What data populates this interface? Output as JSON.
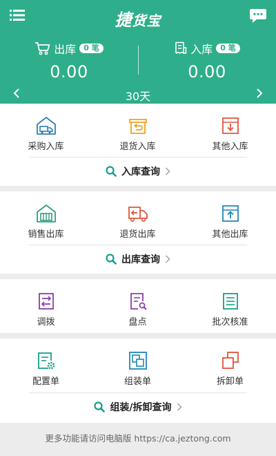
{
  "header": {
    "brand_char": "捷",
    "brand_rest": "货宝",
    "menu_icon": "hamburger-icon",
    "message_icon": "chat-icon"
  },
  "stats": {
    "outbound": {
      "label": "出库",
      "badge": "0 笔",
      "value": "0.00",
      "icon": "cart-icon"
    },
    "inbound": {
      "label": "入库",
      "badge": "0 笔",
      "value": "0.00",
      "icon": "receipt-icon"
    }
  },
  "period": {
    "label": "30天"
  },
  "inbound_section": {
    "items": [
      {
        "label": "采购入库",
        "icon": "purchase-warehouse-icon"
      },
      {
        "label": "退货入库",
        "icon": "return-in-box-icon"
      },
      {
        "label": "其他入库",
        "icon": "other-in-box-icon"
      }
    ],
    "query_label": "入库查询"
  },
  "outbound_section": {
    "items": [
      {
        "label": "销售出库",
        "icon": "sales-warehouse-icon"
      },
      {
        "label": "退货出库",
        "icon": "return-truck-icon"
      },
      {
        "label": "其他出库",
        "icon": "other-out-box-icon"
      }
    ],
    "query_label": "出库查询"
  },
  "misc_section": {
    "items": [
      {
        "label": "调拨",
        "icon": "transfer-icon"
      },
      {
        "label": "盘点",
        "icon": "stocktake-icon"
      },
      {
        "label": "批次核准",
        "icon": "batch-check-icon"
      }
    ]
  },
  "assembly_section": {
    "items": [
      {
        "label": "配置单",
        "icon": "config-sheet-icon"
      },
      {
        "label": "组装单",
        "icon": "assembly-icon"
      },
      {
        "label": "拆卸单",
        "icon": "disassembly-icon"
      }
    ],
    "query_label": "组装/拆卸查询"
  },
  "footer": {
    "text": "更多功能请访问电脑版 https://ca.jeztong.com"
  },
  "colors": {
    "brand_green": "#2eae8a",
    "icon_blue": "#2f7fb3",
    "icon_orange": "#f0a020",
    "icon_red": "#e0543a",
    "icon_purple": "#8a3ea8",
    "icon_teal": "#159f8a"
  }
}
